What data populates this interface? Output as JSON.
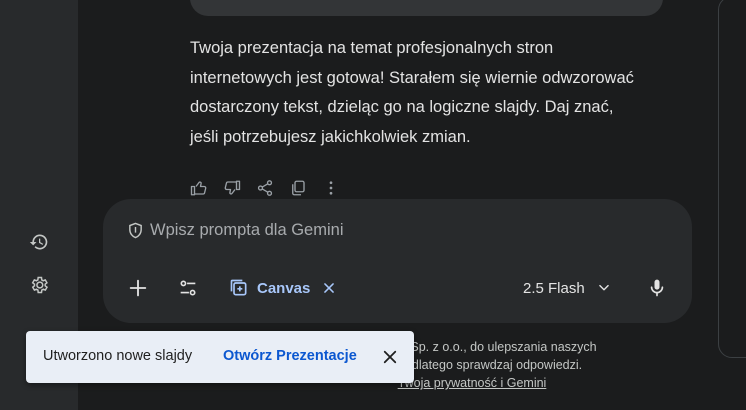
{
  "response": {
    "text": "Twoja prezentacja na temat profesjonalnych stron internetowych jest gotowa! Starałem się wiernie odwzorować dostarczony tekst, dzieląc go na logiczne slajdy. Daj znać, jeśli potrzebujesz jakichkolwiek zmian."
  },
  "composer": {
    "placeholder": "Wpisz prompta dla Gemini",
    "canvas_label": "Canvas",
    "model_label": "2.5 Flash"
  },
  "footer": {
    "line1": "ako TJSoft Sp. z o.o., do ulepszania naszych",
    "line2": "do ludzi, dlatego sprawdzaj odpowiedzi.",
    "privacy_link": "Twoja prywatność i Gemini"
  },
  "toast": {
    "message": "Utworzono nowe slajdy",
    "action": "Otwórz Prezentacje"
  },
  "colors": {
    "accent": "#a8c7fa",
    "toast_action": "#0b57d0",
    "background": "#1b1c1d",
    "surface": "#282a2c"
  }
}
